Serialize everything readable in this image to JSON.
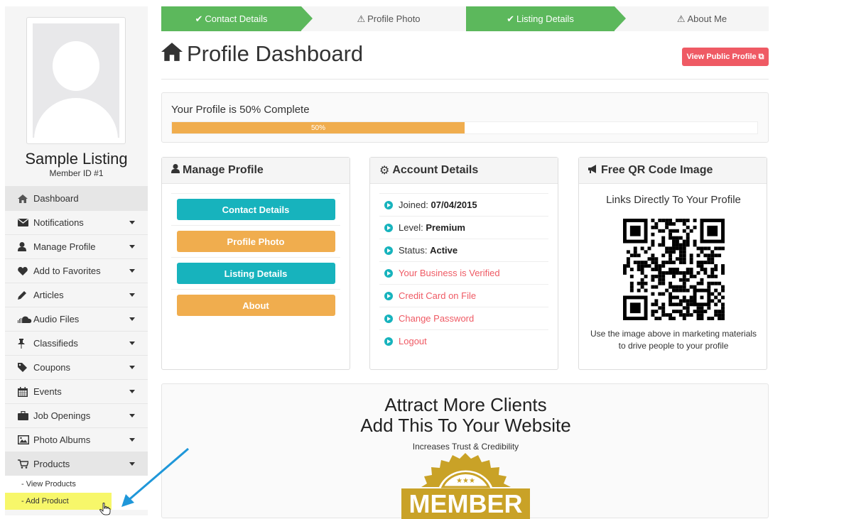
{
  "wizard": {
    "steps": [
      {
        "label": "Contact Details",
        "state": "done"
      },
      {
        "label": "Profile Photo",
        "state": "pending"
      },
      {
        "label": "Listing Details",
        "state": "done"
      },
      {
        "label": "About Me",
        "state": "pending"
      }
    ]
  },
  "sidebar": {
    "listing_name": "Sample Listing",
    "member_id": "Member ID #1",
    "items": [
      {
        "label": "Dashboard",
        "icon": "home-icon"
      },
      {
        "label": "Notifications",
        "icon": "envelope-icon"
      },
      {
        "label": "Manage Profile",
        "icon": "user-icon"
      },
      {
        "label": "Add to Favorites",
        "icon": "heart-icon"
      },
      {
        "label": "Articles",
        "icon": "pencil-icon"
      },
      {
        "label": "Audio Files",
        "icon": "soundcloud-icon"
      },
      {
        "label": "Classifieds",
        "icon": "pushpin-icon"
      },
      {
        "label": "Coupons",
        "icon": "tag-icon"
      },
      {
        "label": "Events",
        "icon": "calendar-icon"
      },
      {
        "label": "Job Openings",
        "icon": "briefcase-icon"
      },
      {
        "label": "Photo Albums",
        "icon": "picture-icon"
      },
      {
        "label": "Products",
        "icon": "cart-icon"
      }
    ],
    "products_sub": [
      "- View Products",
      "- Add Product"
    ]
  },
  "header": {
    "title": "Profile Dashboard",
    "view_public": "View Public Profile"
  },
  "progress": {
    "title": "Your Profile is 50% Complete",
    "percent_label": "50%",
    "value": 0.5,
    "color": "#f0ad4e"
  },
  "manage_profile": {
    "title": "Manage Profile",
    "buttons": [
      "Contact Details",
      "Profile Photo",
      "Listing Details",
      "About"
    ]
  },
  "account": {
    "title": "Account Details",
    "joined_label": "Joined:",
    "joined_value": "07/04/2015",
    "level_label": "Level:",
    "level_value": "Premium",
    "status_label": "Status:",
    "status_value": "Active",
    "links": [
      "Your Business is Verified",
      "Credit Card on File",
      "Change Password",
      "Logout"
    ]
  },
  "qr": {
    "title": "Free QR Code Image",
    "subtitle": "Links Directly To Your Profile",
    "note": "Use the image above in marketing materials to drive people to your profile"
  },
  "attract": {
    "line1": "Attract More Clients",
    "line2": "Add This To Your Website",
    "sub": "Increases Trust & Credibility",
    "badge_text": "MEMBER"
  },
  "colors": {
    "success": "#5cb85c",
    "teal": "#17b3bd",
    "orange": "#f0ad4e",
    "danger": "#ef5a64",
    "badge_gold": "#c9a227"
  }
}
